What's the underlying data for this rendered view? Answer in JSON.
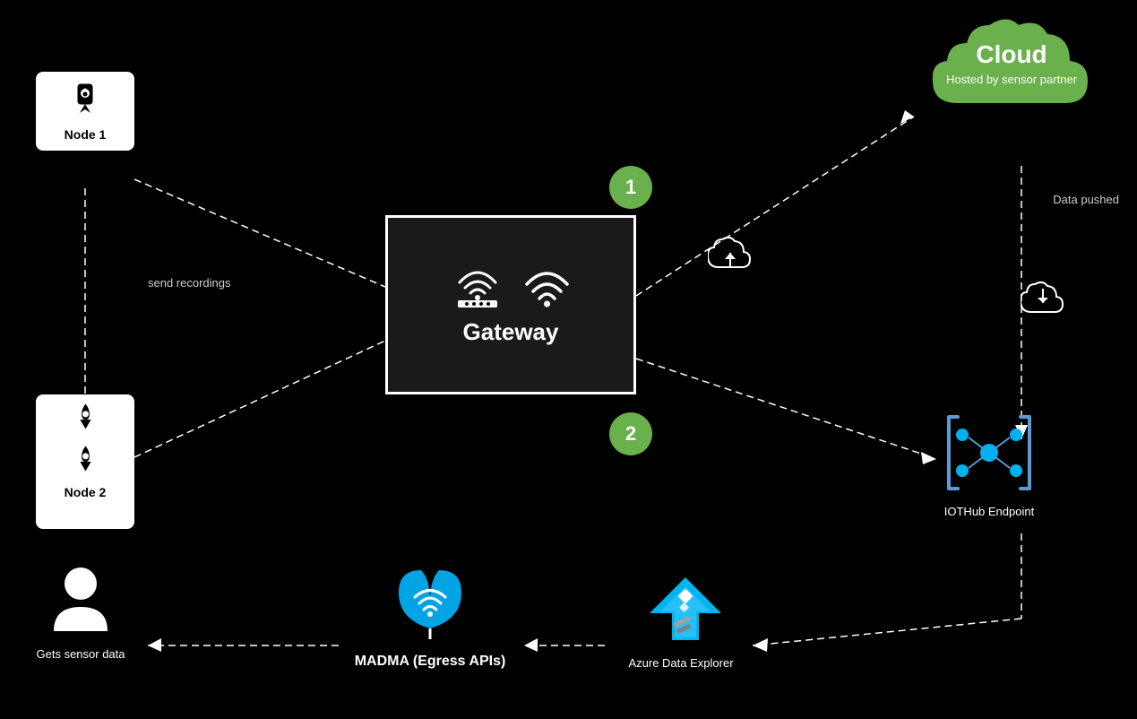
{
  "cloud": {
    "title": "Cloud",
    "subtitle": "Hosted by sensor partner"
  },
  "node1": {
    "label": "Node 1"
  },
  "node2": {
    "label": "Node 2"
  },
  "gateway": {
    "label": "Gateway"
  },
  "numbers": {
    "one": "1",
    "two": "2"
  },
  "iothub": {
    "label": "IOTHub Endpoint"
  },
  "person": {
    "label": "Gets sensor data"
  },
  "madma": {
    "label": "MADMA  (Egress APIs)"
  },
  "azure": {
    "label": "Azure Data Explorer"
  },
  "arrows": {
    "send_recordings": "send recordings",
    "data_pushed": "Data pushed"
  },
  "colors": {
    "cloud_green": "#6ab04c",
    "dashed_line": "#ffffff",
    "gateway_bg": "#1a1a1a"
  }
}
